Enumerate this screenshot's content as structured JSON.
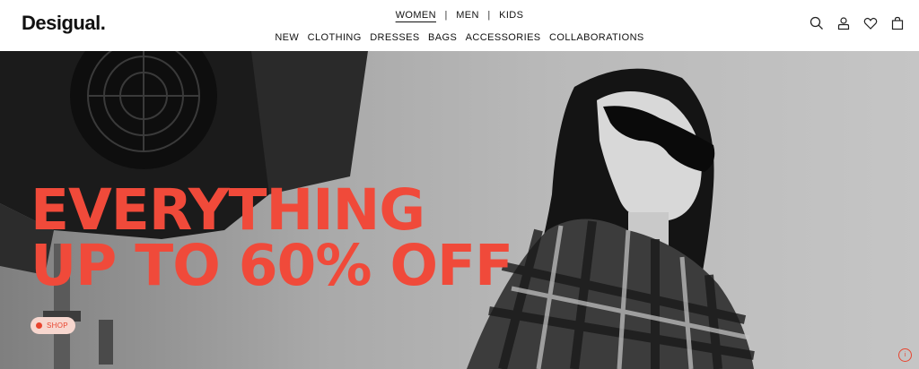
{
  "header": {
    "logo": "Desigual.",
    "gender_nav": [
      {
        "label": "WOMEN",
        "active": true
      },
      {
        "label": "MEN",
        "active": false
      },
      {
        "label": "KIDS",
        "active": false
      }
    ],
    "gender_separator": "|",
    "categories": [
      "NEW",
      "CLOTHING",
      "DRESSES",
      "BAGS",
      "ACCESSORIES",
      "COLLABORATIONS"
    ],
    "icons": [
      "search-icon",
      "account-icon",
      "wishlist-heart-icon",
      "shopping-bag-icon"
    ]
  },
  "hero": {
    "headline_line1": "EVERYTHING",
    "headline_line2": "UP TO 60% OFF",
    "cta_label": "SHOP",
    "info_label": "i",
    "accent_color": "#f04a3a"
  }
}
